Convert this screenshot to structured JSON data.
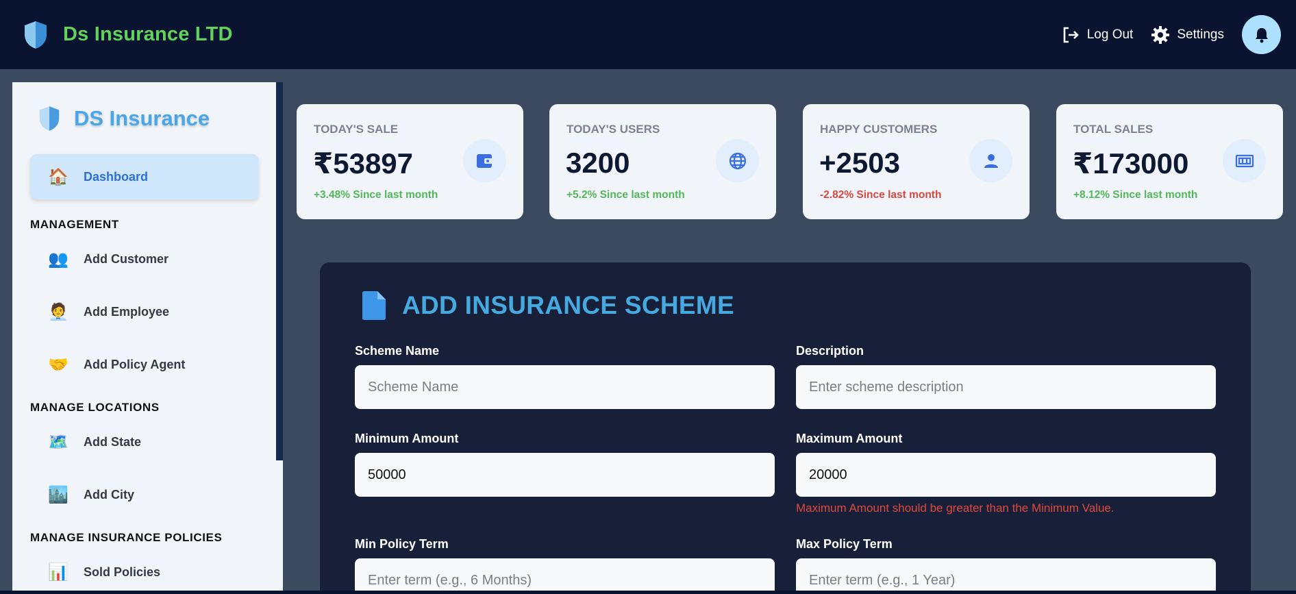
{
  "topbar": {
    "brand_title": "Ds Insurance LTD",
    "brand_icon": "shield-icon",
    "logout_label": "Log Out",
    "settings_label": "Settings",
    "bell_icon": "bell-icon"
  },
  "sidebar": {
    "brand_title": "DS Insurance",
    "active_item": {
      "label": "Dashboard",
      "icon": "🏠"
    },
    "sections": [
      {
        "title": "MANAGEMENT",
        "items": [
          {
            "label": "Add Customer",
            "icon": "👥"
          },
          {
            "label": "Add Employee",
            "icon": "🧑‍💼"
          },
          {
            "label": "Add Policy Agent",
            "icon": "🤝"
          }
        ]
      },
      {
        "title": "MANAGE LOCATIONS",
        "items": [
          {
            "label": "Add State",
            "icon": "🗺️"
          },
          {
            "label": "Add City",
            "icon": "🏙️"
          }
        ]
      },
      {
        "title": "MANAGE INSURANCE POLICIES",
        "items": [
          {
            "label": "Sold Policies",
            "icon": "📊"
          }
        ]
      }
    ]
  },
  "cards": [
    {
      "title": "TODAY'S SALE",
      "value": "₹53897",
      "change": "+3.48% Since last month",
      "trend": "up",
      "icon": "wallet-icon"
    },
    {
      "title": "TODAY'S USERS",
      "value": "3200",
      "change": "+5.2% Since last month",
      "trend": "up",
      "icon": "globe-icon"
    },
    {
      "title": "HAPPY CUSTOMERS",
      "value": "+2503",
      "change": "-2.82% Since last month",
      "trend": "down",
      "icon": "person-icon"
    },
    {
      "title": "TOTAL SALES",
      "value": "₹173000",
      "change": "+8.12% Since last month",
      "trend": "up",
      "icon": "money-icon"
    }
  ],
  "form": {
    "title": "ADD INSURANCE SCHEME",
    "scheme_name": {
      "label": "Scheme Name",
      "placeholder": "Scheme Name",
      "value": ""
    },
    "description": {
      "label": "Description",
      "placeholder": "Enter scheme description",
      "value": ""
    },
    "min_amount": {
      "label": "Minimum Amount",
      "placeholder": "",
      "value": "50000"
    },
    "max_amount": {
      "label": "Maximum Amount",
      "placeholder": "",
      "value": "20000",
      "error": "Maximum Amount should be greater than the Minimum Value."
    },
    "min_term": {
      "label": "Min Policy Term",
      "placeholder": "Enter term (e.g., 6 Months)",
      "value": ""
    },
    "max_term": {
      "label": "Max Policy Term",
      "placeholder": "Enter term (e.g., 1 Year)",
      "value": ""
    }
  },
  "colors": {
    "navbar": "#0a1330",
    "brand_green": "#5fd35c",
    "accent_blue": "#46a9e0",
    "positive": "#52b85a",
    "negative": "#d9473f"
  }
}
